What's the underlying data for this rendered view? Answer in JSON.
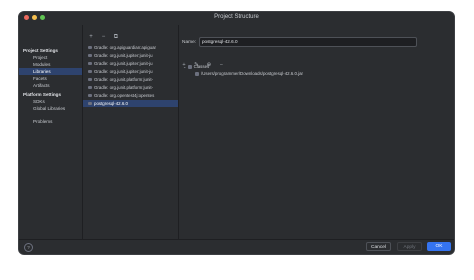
{
  "window": {
    "title": "Project Structure"
  },
  "nav": {
    "project_settings_header": "Project Settings",
    "project_items": [
      "Project",
      "Modules",
      "Libraries",
      "Facets",
      "Artifacts"
    ],
    "platform_settings_header": "Platform Settings",
    "platform_items": [
      "SDKs",
      "Global Libraries"
    ],
    "problems": "Problems",
    "selected": "Libraries"
  },
  "libraries": {
    "toolbar_icons": [
      "plus-icon",
      "minus-icon",
      "copy-icon"
    ],
    "toolbar_glyphs": [
      "+",
      "−",
      "⧉"
    ],
    "items": [
      "Gradle: org.apiguardian:apiguar",
      "Gradle: org.junit.jupiter:junit-ju",
      "Gradle: org.junit.jupiter:junit-ju",
      "Gradle: org.junit.jupiter:junit-ju",
      "Gradle: org.junit.platform:junit-",
      "Gradle: org.junit.platform:junit-",
      "Gradle: org.opentest4j:opentes",
      "postgresql-42.6.0"
    ],
    "selected_index": 7
  },
  "detail": {
    "name_label": "Name:",
    "name_value": "postgresql-42.6.0",
    "toolbar_glyphs": [
      "+",
      "✎",
      "⊕",
      "−"
    ],
    "classes_label": "Classes",
    "class_path": "/Users/programmer/Downloads/postgresql-42.6.0.jar"
  },
  "footer": {
    "help": "?",
    "cancel": "Cancel",
    "apply": "Apply",
    "ok": "OK"
  },
  "colors": {
    "accent": "#3574f0",
    "selection": "#2e436e",
    "background": "#2b2d30"
  }
}
